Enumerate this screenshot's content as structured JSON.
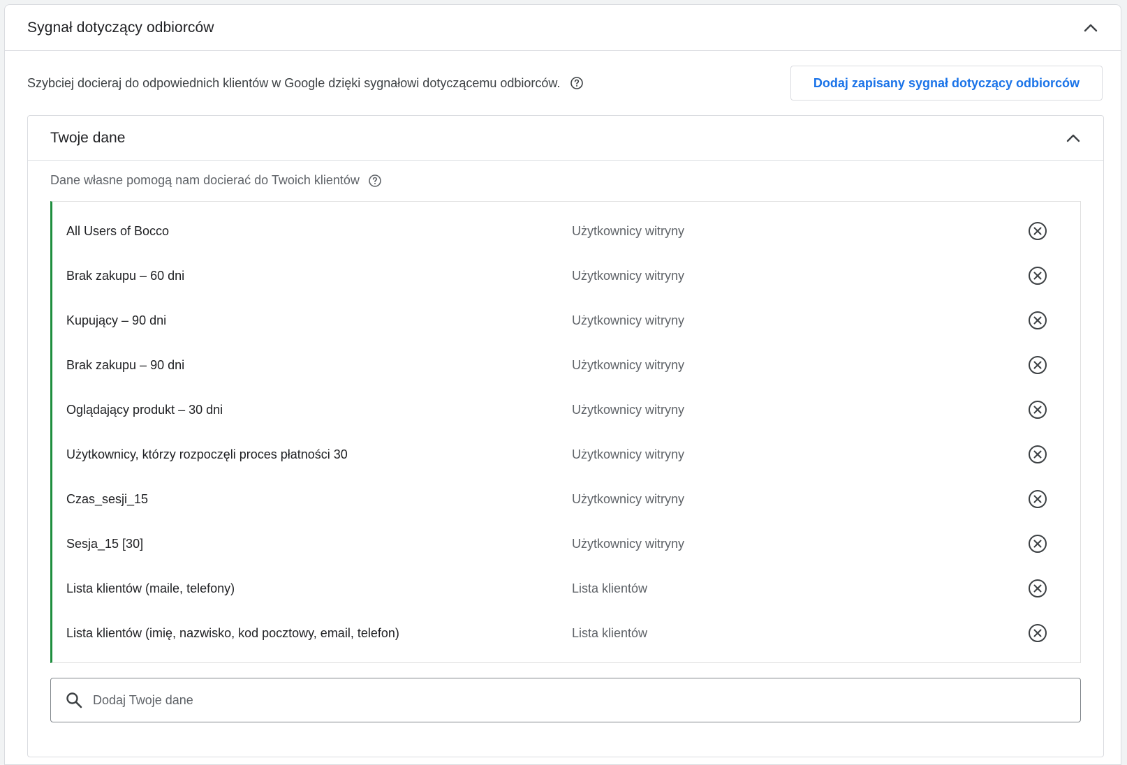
{
  "audience_signal": {
    "title": "Sygnał dotyczący odbiorców",
    "intro_text": "Szybciej docieraj do odpowiednich klientów w Google dzięki sygnałowi dotyczącemu odbiorców.",
    "saved_signal_button": "Dodaj zapisany sygnał dotyczący odbiorców"
  },
  "your_data": {
    "title": "Twoje dane",
    "subtitle": "Dane własne pomogą nam docierać do Twoich klientów",
    "rows": [
      {
        "name": "All Users of Bocco",
        "type": "Użytkownicy witryny"
      },
      {
        "name": "Brak zakupu – 60 dni",
        "type": "Użytkownicy witryny"
      },
      {
        "name": "Kupujący – 90 dni",
        "type": "Użytkownicy witryny"
      },
      {
        "name": "Brak zakupu – 90 dni",
        "type": "Użytkownicy witryny"
      },
      {
        "name": "Oglądający produkt – 30 dni",
        "type": "Użytkownicy witryny"
      },
      {
        "name": "Użytkownicy, którzy rozpoczęli proces płatności 30",
        "type": "Użytkownicy witryny"
      },
      {
        "name": "Czas_sesji_15",
        "type": "Użytkownicy witryny"
      },
      {
        "name": "Sesja_15 [30]",
        "type": "Użytkownicy witryny"
      },
      {
        "name": "Lista klientów (maile, telefony)",
        "type": "Lista klientów"
      },
      {
        "name": "Lista klientów (imię, nazwisko, kod pocztowy, email, telefon)",
        "type": "Lista klientów"
      }
    ],
    "search_placeholder": "Dodaj Twoje dane"
  },
  "colors": {
    "accent_blue": "#1a73e8",
    "list_accent_green": "#1e8e3e",
    "border": "#dadce0"
  },
  "icons": {
    "collapse": "chevron-up-icon",
    "help": "help-circle-icon",
    "remove": "close-circle-icon",
    "search": "search-icon"
  }
}
